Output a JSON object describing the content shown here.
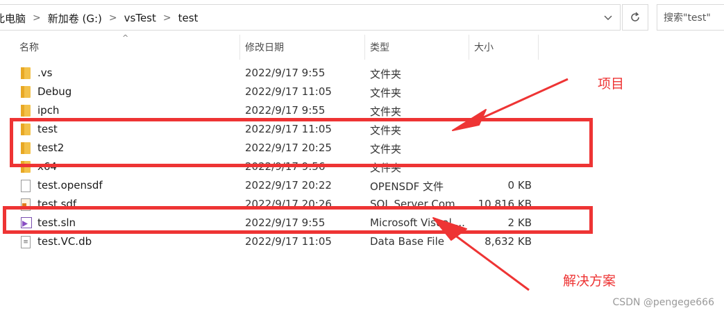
{
  "address_bar": {
    "crumbs": [
      "此电脑",
      "新加卷 (G:)",
      "vsTest",
      "test"
    ],
    "dropdown_icon": "chevron-down-icon",
    "refresh_icon": "refresh-icon",
    "search_placeholder": "搜索\"test\""
  },
  "columns": {
    "name": "名称",
    "date": "修改日期",
    "type": "类型",
    "size": "大小"
  },
  "files": [
    {
      "name": ".vs",
      "date": "2022/9/17 9:55",
      "type": "文件夹",
      "size": "",
      "icon": "folder-icon"
    },
    {
      "name": "Debug",
      "date": "2022/9/17 11:05",
      "type": "文件夹",
      "size": "",
      "icon": "folder-icon"
    },
    {
      "name": "ipch",
      "date": "2022/9/17 9:55",
      "type": "文件夹",
      "size": "",
      "icon": "folder-icon"
    },
    {
      "name": "test",
      "date": "2022/9/17 11:05",
      "type": "文件夹",
      "size": "",
      "icon": "folder-icon"
    },
    {
      "name": "test2",
      "date": "2022/9/17 20:25",
      "type": "文件夹",
      "size": "",
      "icon": "folder-icon"
    },
    {
      "name": "x64",
      "date": "2022/9/17 9:56",
      "type": "文件夹",
      "size": "",
      "icon": "folder-icon"
    },
    {
      "name": "test.opensdf",
      "date": "2022/9/17 20:22",
      "type": "OPENSDF 文件",
      "size": "0 KB",
      "icon": "file-icon"
    },
    {
      "name": "test.sdf",
      "date": "2022/9/17 20:26",
      "type": "SQL Server Com...",
      "size": "10,816 KB",
      "icon": "sql-file-icon"
    },
    {
      "name": "test.sln",
      "date": "2022/9/17 9:55",
      "type": "Microsoft Visual ...",
      "size": "2 KB",
      "icon": "visual-studio-solution-icon"
    },
    {
      "name": "test.VC.db",
      "date": "2022/9/17 11:05",
      "type": "Data Base File",
      "size": "8,632 KB",
      "icon": "database-file-icon"
    }
  ],
  "annotations": {
    "project_label": "项目",
    "solution_label": "解决方案",
    "color": "#ee3434"
  },
  "watermark": "CSDN @pengege666"
}
